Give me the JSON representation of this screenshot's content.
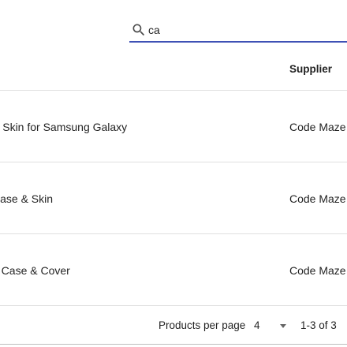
{
  "search": {
    "value": "ca"
  },
  "table": {
    "headers": {
      "supplier": "Supplier"
    },
    "rows": [
      {
        "name": "& Skin for Samsung Galaxy",
        "supplier": "Code Maze"
      },
      {
        "name": "Case & Skin",
        "supplier": "Code Maze"
      },
      {
        "name": "e Case & Cover",
        "supplier": "Code Maze"
      }
    ]
  },
  "pagination": {
    "label": "Products per page",
    "page_size": "4",
    "range": "1-3 of 3"
  },
  "colors": {
    "accent": "#3f51b5",
    "divider": "#e0e0e0"
  }
}
